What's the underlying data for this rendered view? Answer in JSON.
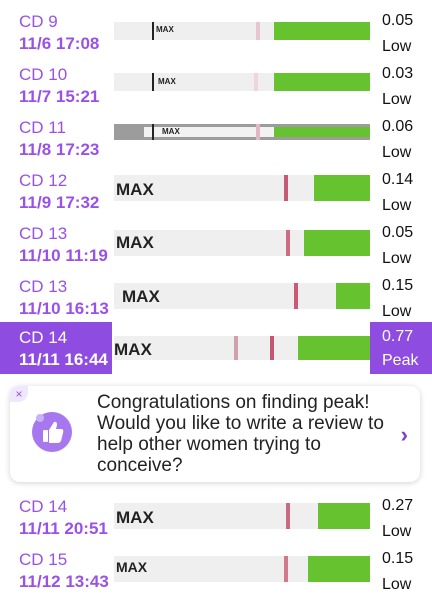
{
  "rows": [
    {
      "cd": "CD 9",
      "dt": "11/6  17:08",
      "val": "0.05",
      "lvl": "Low",
      "strip_text": "MAX"
    },
    {
      "cd": "CD 10",
      "dt": "11/7  15:21",
      "val": "0.03",
      "lvl": "Low",
      "strip_text": "MAX"
    },
    {
      "cd": "CD 11",
      "dt": "11/8  17:23",
      "val": "0.06",
      "lvl": "Low",
      "strip_text": "MAX"
    },
    {
      "cd": "CD 12",
      "dt": "11/9  17:32",
      "val": "0.14",
      "lvl": "Low",
      "strip_text": "MAX"
    },
    {
      "cd": "CD 13",
      "dt": "11/10  11:19",
      "val": "0.05",
      "lvl": "Low",
      "strip_text": "MAX"
    },
    {
      "cd": "CD 13",
      "dt": "11/10  16:13",
      "val": "0.15",
      "lvl": "Low",
      "strip_text": "MAX"
    },
    {
      "cd": "CD 14",
      "dt": "11/11  16:44",
      "val": "0.77",
      "lvl": "Peak",
      "strip_text": "MAX"
    },
    {
      "cd": "CD 14",
      "dt": "11/11  20:51",
      "val": "0.27",
      "lvl": "Low",
      "strip_text": "MAX"
    },
    {
      "cd": "CD 15",
      "dt": "11/12  13:43",
      "val": "0.15",
      "lvl": "Low",
      "strip_text": "MAX"
    }
  ],
  "card": {
    "text": "Congratulations on finding peak! Would you like to write a review to help other women trying to conceive?",
    "close_icon": "×",
    "chevron_icon": "›"
  },
  "colors": {
    "accent": "#8e4ce0",
    "purple_text": "#9a52e6",
    "strip_green": "#66c22e"
  }
}
